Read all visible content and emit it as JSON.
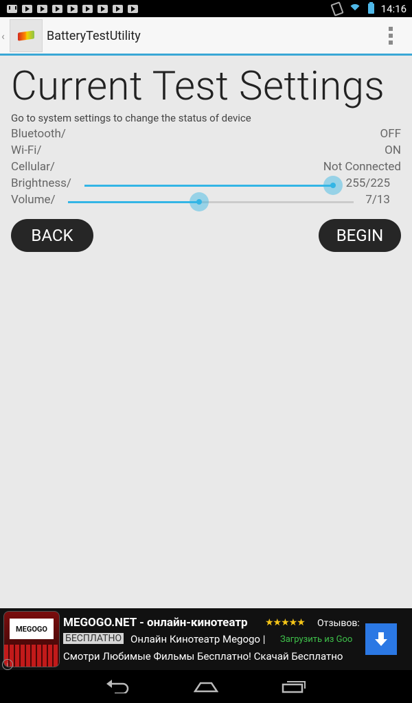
{
  "status_bar": {
    "time": "14:16",
    "notification_icons": [
      "gmail-icon",
      "play-icon",
      "play-icon",
      "play-icon",
      "play-icon",
      "play-icon",
      "play-icon",
      "play-icon",
      "play-icon"
    ]
  },
  "action_bar": {
    "title": "BatteryTestUtility"
  },
  "content": {
    "heading": "Current Test Settings",
    "subtitle": "Go to system settings to change the status of device",
    "rows": [
      {
        "label": "Bluetooth/",
        "value": "OFF"
      },
      {
        "label": "Wi-Fi/",
        "value": "ON"
      },
      {
        "label": "Cellular/",
        "value": "Not Connected"
      },
      {
        "label": "Brightness/",
        "value": "255/225",
        "level": 1.0
      },
      {
        "label": "Volume/",
        "value": "7/13",
        "level": 0.46
      }
    ],
    "back_label": "BACK",
    "begin_label": "BEGIN"
  },
  "ad": {
    "logo_text": "MEGOGO",
    "title": "MEGOGO.NET - онлайн-кинотеатр",
    "stars": "★★★★★",
    "review_label": "Отзывов:",
    "free_badge": "БЕСПЛАТНО",
    "line2": "Онлайн Кинотеатр Megogo |",
    "store_text": "Загрузить из Goo",
    "line3": "Смотри Любимые Фильмы Бесплатно! Скачай Бесплатно"
  },
  "colors": {
    "accent": "#33b5e5",
    "button_bg": "#262626",
    "background": "#e9e9e9"
  }
}
